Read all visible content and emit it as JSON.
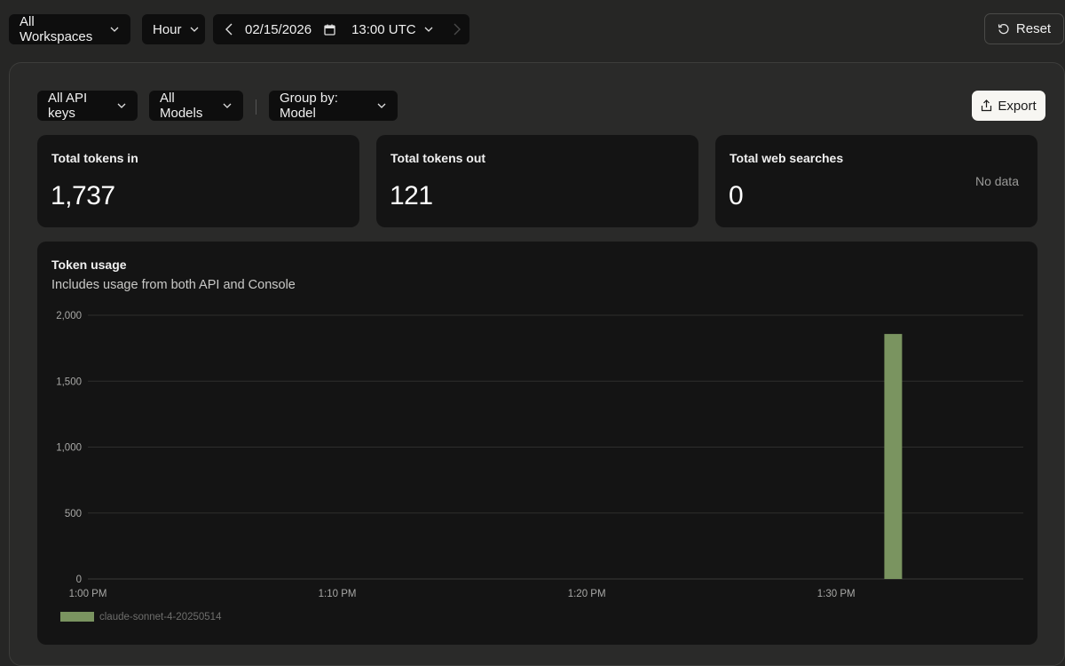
{
  "topbar": {
    "workspace": "All Workspaces",
    "granularity": "Hour",
    "date": "02/15/2026",
    "time": "13:00 UTC",
    "reset_label": "Reset"
  },
  "filters": {
    "api_keys": "All API keys",
    "models": "All Models",
    "group_by": "Group by: Model",
    "export_label": "Export"
  },
  "stats": [
    {
      "title": "Total tokens in",
      "value": "1,737",
      "note": ""
    },
    {
      "title": "Total tokens out",
      "value": "121",
      "note": ""
    },
    {
      "title": "Total web searches",
      "value": "0",
      "note": "No data"
    }
  ],
  "usage_chart": {
    "title": "Token usage",
    "subtitle": "Includes usage from both API and Console"
  },
  "colors": {
    "series": "#7a9460",
    "background": "#262625",
    "card": "#141414",
    "gridline": "#2e2e2d"
  },
  "chart_data": {
    "type": "bar",
    "title": "Token usage",
    "subtitle": "Includes usage from both API and Console",
    "xlabel": "",
    "ylabel": "",
    "ylim": [
      0,
      2000
    ],
    "yticks": [
      "2,000",
      "1,500",
      "1,000",
      "500",
      "0"
    ],
    "ytick_values": [
      2000,
      1500,
      1000,
      500,
      0
    ],
    "xticks": [
      "1:00 PM",
      "1:10 PM",
      "1:20 PM",
      "1:30 PM"
    ],
    "xtick_minutes": [
      0,
      10,
      20,
      30
    ],
    "x_range_minutes": [
      0,
      37.5
    ],
    "grid": true,
    "legend_position": "bottom-left",
    "series": [
      {
        "name": "claude-sonnet-4-20250514",
        "color": "#7a9460",
        "points": [
          {
            "minute": 32,
            "value": 1858
          }
        ]
      }
    ]
  }
}
